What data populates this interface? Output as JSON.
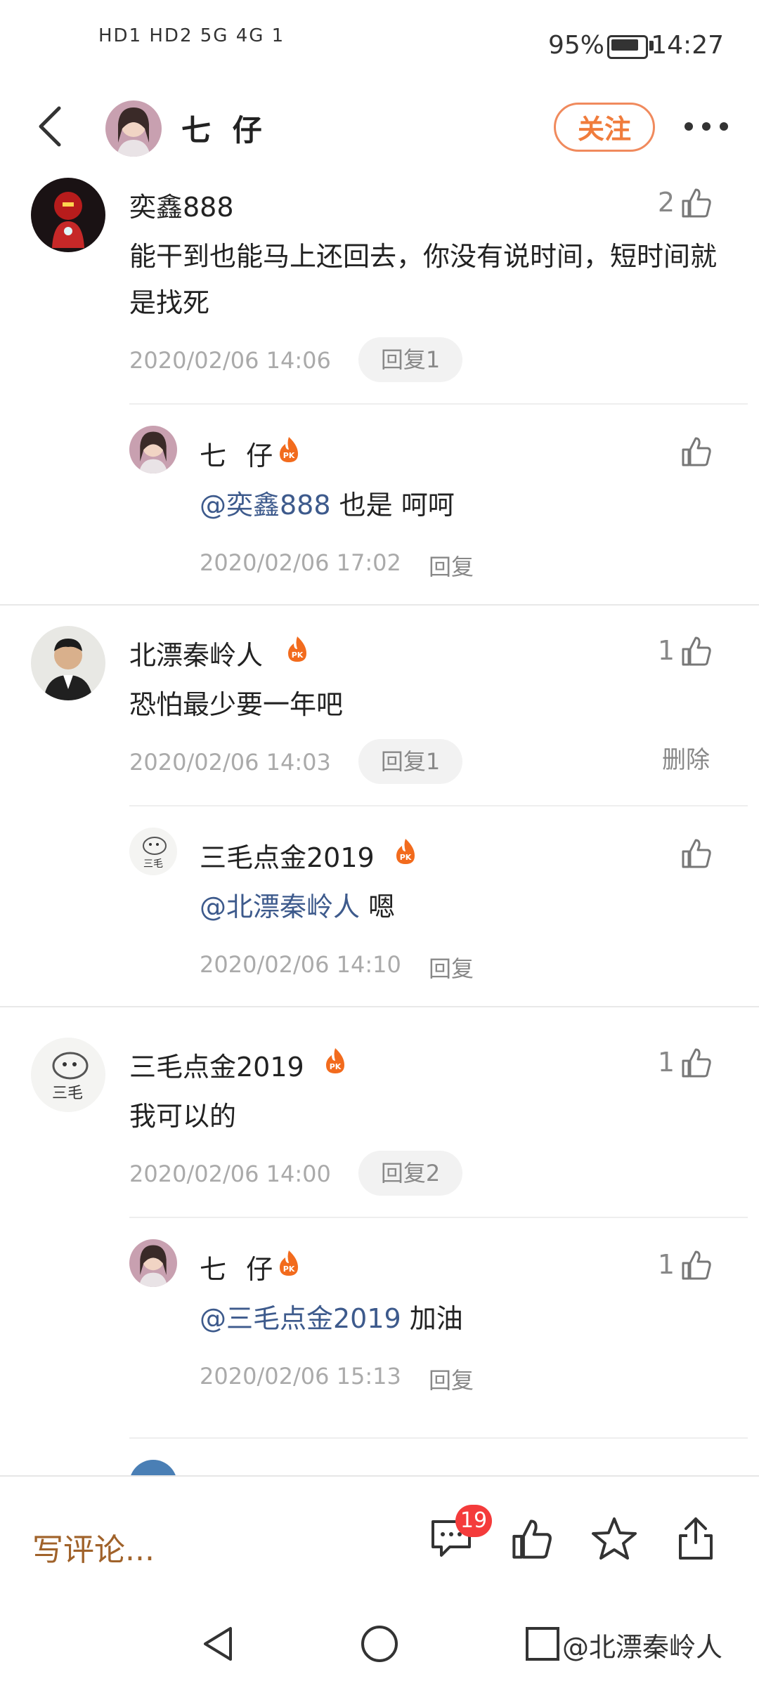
{
  "status_bar": {
    "signal_text": "HD1 HD2 5G 4G 1",
    "battery": "95%",
    "time": "14:27"
  },
  "header": {
    "title": "七 仔",
    "follow_label": "关注"
  },
  "comments": [
    {
      "user": "奕鑫888",
      "text": "能干到也能马上还回去，你没有说时间，短时间就是找死",
      "time": "2020/02/06 14:06",
      "reply_label": "回复1",
      "likes": "2",
      "reply": {
        "user": "七 仔",
        "mention": "@奕鑫888",
        "text": " 也是 呵呵",
        "time": "2020/02/06 17:02",
        "reply_label": "回复",
        "likes": ""
      }
    },
    {
      "user": "北漂秦岭人",
      "text": "恐怕最少要一年吧",
      "time": "2020/02/06 14:03",
      "reply_label": "回复1",
      "likes": "1",
      "delete_label": "删除",
      "reply": {
        "user": "三毛点金2019",
        "mention": "@北漂秦岭人",
        "text": " 嗯",
        "time": "2020/02/06 14:10",
        "reply_label": "回复",
        "likes": ""
      }
    },
    {
      "user": "三毛点金2019",
      "text": "我可以的",
      "time": "2020/02/06 14:00",
      "reply_label": "回复2",
      "likes": "1",
      "reply": {
        "user": "七 仔",
        "mention": "@三毛点金2019",
        "text": " 加油",
        "time": "2020/02/06 15:13",
        "reply_label": "回复",
        "likes": "1"
      }
    }
  ],
  "bottom_bar": {
    "write_placeholder": "写评论...",
    "comment_count": "19"
  },
  "watermark": "@北漂秦岭人",
  "colors": {
    "accent": "#f07c3c",
    "mention": "#3d5a8c",
    "badge": "#f43b3b"
  }
}
